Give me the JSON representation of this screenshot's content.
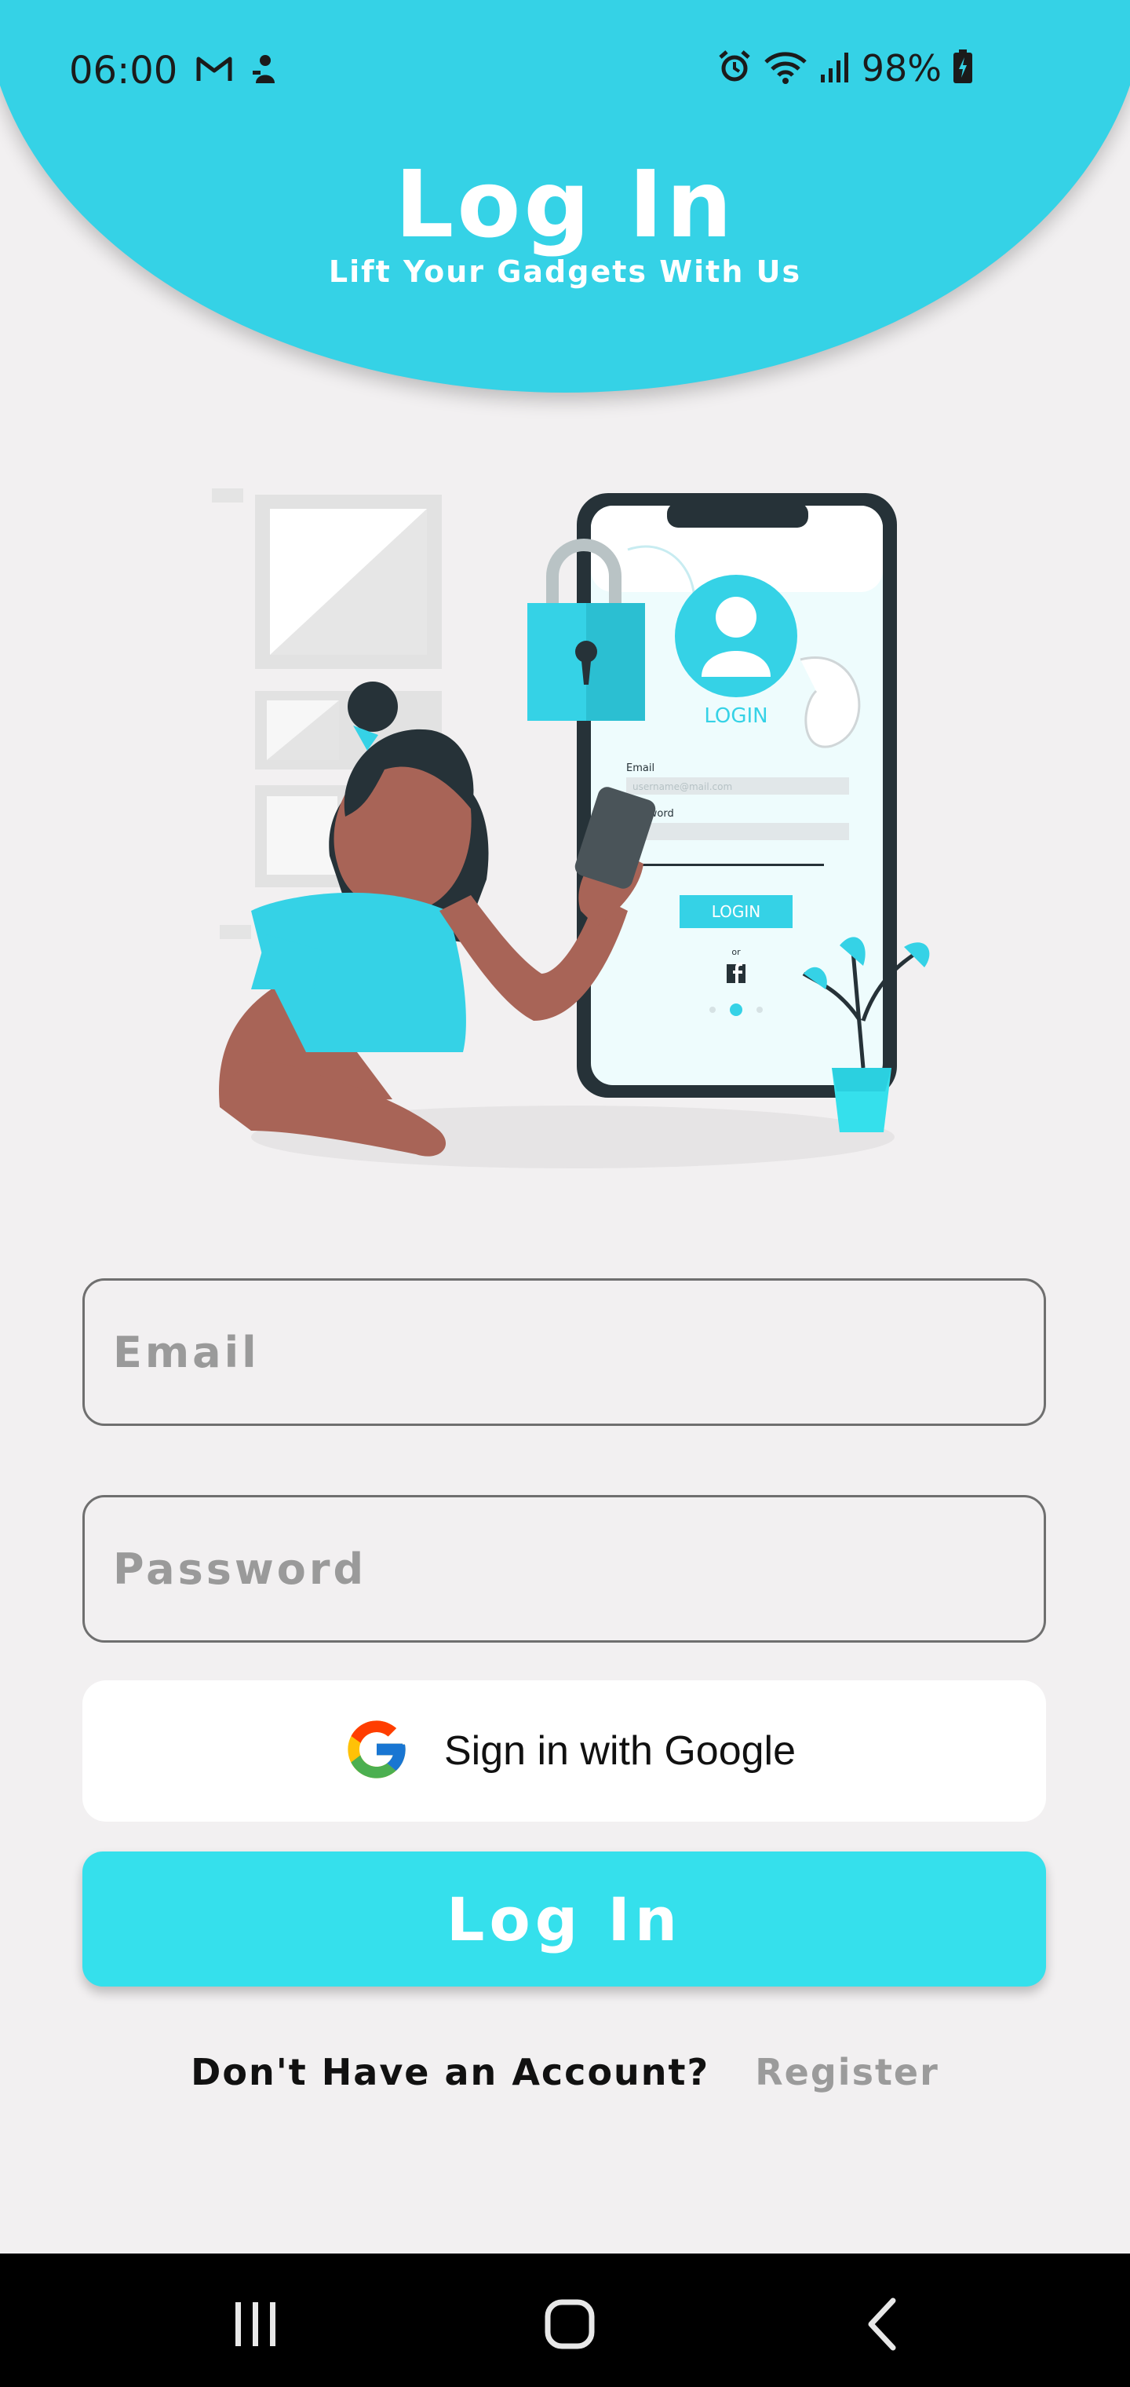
{
  "status_bar": {
    "time": "06:00",
    "battery": "98%",
    "icons_left": [
      "gmail-icon",
      "notification-figure-icon"
    ],
    "icons_right": [
      "alarm-icon",
      "wifi-icon",
      "signal-icon",
      "battery-charging-icon"
    ]
  },
  "header": {
    "title": "Log In",
    "subtitle": "Lift Your Gadgets With Us"
  },
  "illustration": {
    "phone_title": "LOGIN",
    "email_label": "Email",
    "password_label": "Password",
    "email_placeholder": "username@mail.com",
    "button_label": "LOGIN",
    "or_label": "or"
  },
  "form": {
    "email_placeholder": "Email",
    "password_placeholder": "Password",
    "google_label": "Sign in with Google",
    "login_label": "Log In"
  },
  "footer": {
    "question": "Don't Have an Account?",
    "register": "Register"
  },
  "colors": {
    "accent": "#35d2e6",
    "button": "#35e0ec",
    "background": "#f2f0f1"
  }
}
